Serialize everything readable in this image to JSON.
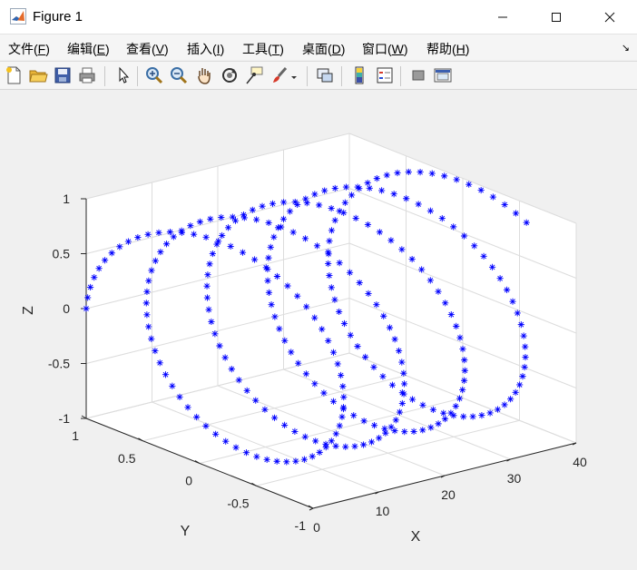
{
  "window": {
    "title": "Figure 1",
    "minimize_icon": "minimize-icon",
    "maximize_icon": "maximize-icon",
    "close_icon": "close-icon"
  },
  "menu": {
    "items": [
      {
        "label": "文件(",
        "acc": "F",
        "tail": ")"
      },
      {
        "label": "编辑(",
        "acc": "E",
        "tail": ")"
      },
      {
        "label": "查看(",
        "acc": "V",
        "tail": ")"
      },
      {
        "label": "插入(",
        "acc": "I",
        "tail": ")"
      },
      {
        "label": "工具(",
        "acc": "T",
        "tail": ")"
      },
      {
        "label": "桌面(",
        "acc": "D",
        "tail": ")"
      },
      {
        "label": "窗口(",
        "acc": "W",
        "tail": ")"
      },
      {
        "label": "帮助(",
        "acc": "H",
        "tail": ")"
      }
    ]
  },
  "toolbar": {
    "icons": [
      "new-figure-icon",
      "open-file-icon",
      "save-icon",
      "print-icon",
      "select-arrow-icon",
      "zoom-in-icon",
      "zoom-out-icon",
      "pan-hand-icon",
      "rotate-3d-icon",
      "data-cursor-icon",
      "brush-icon",
      "brush-dropdown-icon",
      "link-plot-icon",
      "colorbar-icon",
      "legend-icon",
      "hide-plot-tools-icon",
      "show-plot-tools-icon"
    ]
  },
  "colors": {
    "marker": "#0000ff",
    "axes_bg": "#ffffff",
    "figure_bg": "#f0f0f0",
    "grid": "#dcdcdc",
    "axis_line": "#262626"
  },
  "chart_data": {
    "type": "scatter",
    "projection": "3d",
    "marker": "*",
    "marker_color": "#0000ff",
    "title": "",
    "xlabel": "X",
    "ylabel": "Y",
    "zlabel": "Z",
    "xlim": [
      0,
      40
    ],
    "ylim": [
      -1,
      1
    ],
    "zlim": [
      -1,
      1
    ],
    "xticks": [
      "0",
      "10",
      "20",
      "30",
      "40"
    ],
    "yticks": [
      "-1",
      "-0.5",
      "0",
      "0.5",
      "1"
    ],
    "zticks": [
      "-1",
      "-0.5",
      "0",
      "0.5",
      "1"
    ],
    "grid": true,
    "series": [
      {
        "t_start": 0,
        "t_end": 27.3,
        "t_step": 0.1,
        "x": "t * 40 / 27.3",
        "y": "cos(t)",
        "z": "sin(t)",
        "x_range": [
          0,
          40
        ],
        "points": 274
      }
    ]
  }
}
